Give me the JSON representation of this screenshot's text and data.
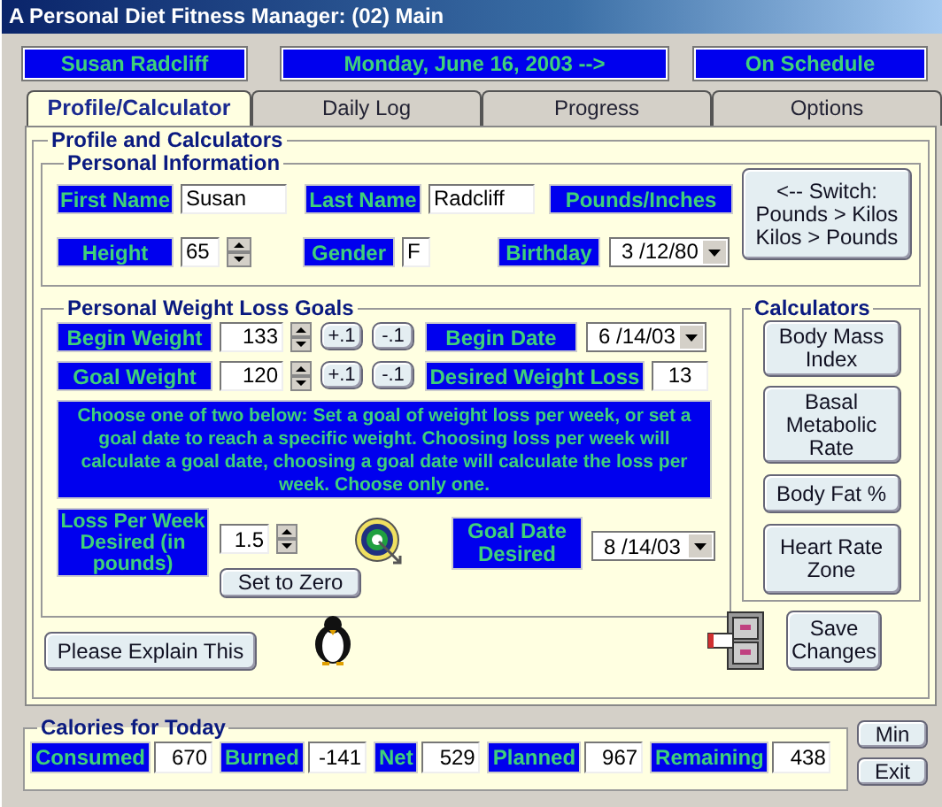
{
  "window": {
    "title": "A Personal Diet Fitness Manager: (02) Main"
  },
  "header": {
    "user": "Susan Radcliff",
    "date": "Monday, June 16, 2003 -->",
    "status": "On Schedule"
  },
  "tabs": [
    {
      "label": "Profile/Calculator",
      "selected": true
    },
    {
      "label": "Daily Log",
      "selected": false
    },
    {
      "label": "Progress",
      "selected": false
    },
    {
      "label": "Options",
      "selected": false
    }
  ],
  "profile": {
    "title": "Profile and Calculators",
    "personal": {
      "title": "Personal Information",
      "first_name": {
        "label": "First Name",
        "value": "Susan"
      },
      "last_name": {
        "label": "Last Name",
        "value": "Radcliff"
      },
      "units": "Pounds/Inches",
      "switch_button": [
        "<-- Switch:",
        "Pounds > Kilos",
        "Kilos > Pounds"
      ],
      "height": {
        "label": "Height",
        "value": "65"
      },
      "gender": {
        "label": "Gender",
        "value": "F"
      },
      "birthday": {
        "label": "Birthday",
        "value": "3 /12/80"
      }
    },
    "goals": {
      "title": "Personal Weight Loss Goals",
      "weights": [
        {
          "label": "Begin Weight",
          "value": "133",
          "increment": "+.1",
          "decrement": "-.1"
        },
        {
          "label": "Goal Weight",
          "value": "120",
          "increment": "+.1",
          "decrement": "-.1"
        }
      ],
      "begin_date": {
        "label": "Begin Date",
        "value": "6 /14/03"
      },
      "desired_loss": {
        "label": "Desired Weight Loss",
        "value": "13"
      },
      "instructions": "Choose one of two below: Set a goal of weight loss per week, or set a goal date to reach a specific weight. Choosing loss per week will calculate a goal date, choosing a goal date will calculate the loss per week. Choose only one.",
      "loss_per_week": {
        "label": "Loss Per Week Desired (in pounds)",
        "value": "1.5"
      },
      "reset_button": "Set to Zero",
      "goal_date": {
        "label": "Goal Date Desired",
        "value": "8 /14/03"
      }
    },
    "calculators": {
      "title": "Calculators",
      "buttons": [
        "Body Mass Index",
        "Basal Metabolic Rate",
        "Body Fat %",
        "Heart Rate Zone"
      ]
    },
    "explain_button": "Please Explain This",
    "save_button": "Save Changes"
  },
  "calories": {
    "title": "Calories for Today",
    "items": [
      {
        "label": "Consumed",
        "value": "670"
      },
      {
        "label": "Burned",
        "value": "-141"
      },
      {
        "label": "Net",
        "value": "529"
      },
      {
        "label": "Planned",
        "value": "967"
      },
      {
        "label": "Remaining",
        "value": "438"
      }
    ]
  },
  "window_buttons": [
    "Min",
    "Exit"
  ]
}
